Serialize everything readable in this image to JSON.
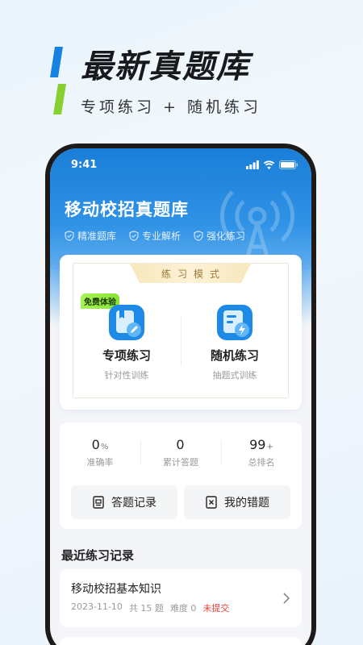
{
  "promo": {
    "title": "最新真题库",
    "subtitle": "专项练习 + 随机练习"
  },
  "status_bar": {
    "time": "9:41",
    "icons": [
      "signal-icon",
      "wifi-icon",
      "battery-icon"
    ]
  },
  "app": {
    "title": "移动校招真题库",
    "features": [
      {
        "icon": "shield-check-icon",
        "label": "精准题库"
      },
      {
        "icon": "shield-check-icon",
        "label": "专业解析"
      },
      {
        "icon": "shield-check-icon",
        "label": "强化练习"
      }
    ]
  },
  "practice_mode": {
    "banner": "练习模式",
    "free_badge": "免费体验",
    "options": [
      {
        "title": "专项练习",
        "subtitle": "针对性训练",
        "icon": "book-edit-icon"
      },
      {
        "title": "随机练习",
        "subtitle": "抽题式训练",
        "icon": "document-lightning-icon"
      }
    ]
  },
  "stats": {
    "items": [
      {
        "value": "0",
        "suffix": "%",
        "label": "准确率"
      },
      {
        "value": "0",
        "suffix": "",
        "label": "累计答题"
      },
      {
        "value": "99",
        "suffix": "+",
        "label": "总排名"
      }
    ],
    "buttons": [
      {
        "label": "答题记录",
        "icon": "record-icon"
      },
      {
        "label": "我的错题",
        "icon": "wrong-answer-icon"
      }
    ]
  },
  "recent": {
    "title": "最近练习记录",
    "records": [
      {
        "title": "移动校招基本知识",
        "date": "2023-11-10",
        "count": "共 15 题",
        "difficulty": "难度 0",
        "status": "未提交"
      }
    ]
  },
  "colors": {
    "header_blue": "#1a7ed8",
    "accent_green": "#86e334",
    "status_red": "#e8423a",
    "banner_gold": "#f7e7bc"
  }
}
